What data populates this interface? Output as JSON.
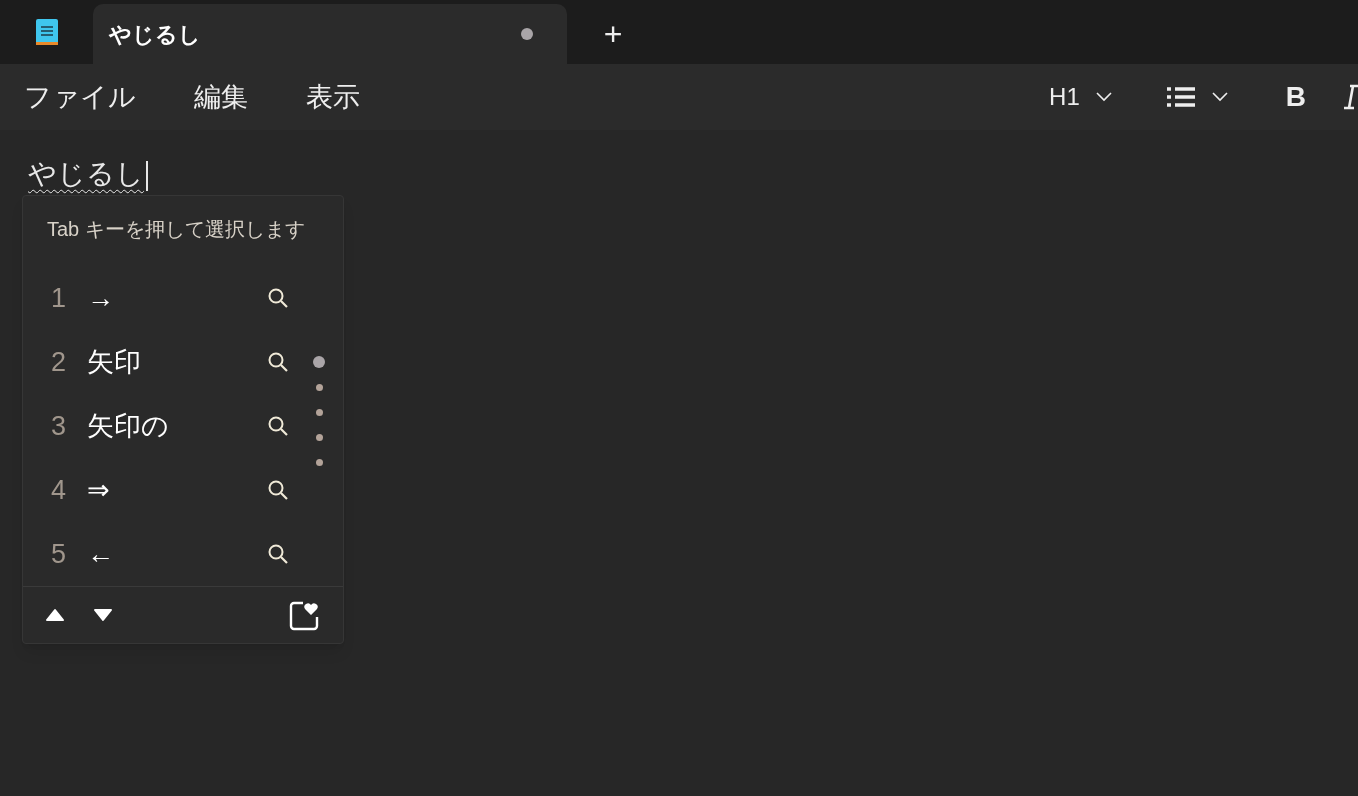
{
  "tabs": [
    {
      "title": "やじるし",
      "selected": true,
      "modified": true
    }
  ],
  "new_tab": "+",
  "menu": [
    "ファイル",
    "編集",
    "表示"
  ],
  "toolbar": {
    "heading": "H1",
    "bold": "B"
  },
  "editor": {
    "text": "やじるし",
    "composing": true
  },
  "ime_popup": {
    "hint": "Tab キーを押して選択します",
    "candidates": [
      {
        "index": "1",
        "text": "→"
      },
      {
        "index": "2",
        "text": "矢印"
      },
      {
        "index": "3",
        "text": "矢印の"
      },
      {
        "index": "4",
        "text": "⇒"
      },
      {
        "index": "5",
        "text": "←"
      }
    ],
    "pages": [
      {
        "selected": true
      },
      {
        "selected": false
      },
      {
        "selected": false
      },
      {
        "selected": false
      },
      {
        "selected": false
      }
    ]
  }
}
